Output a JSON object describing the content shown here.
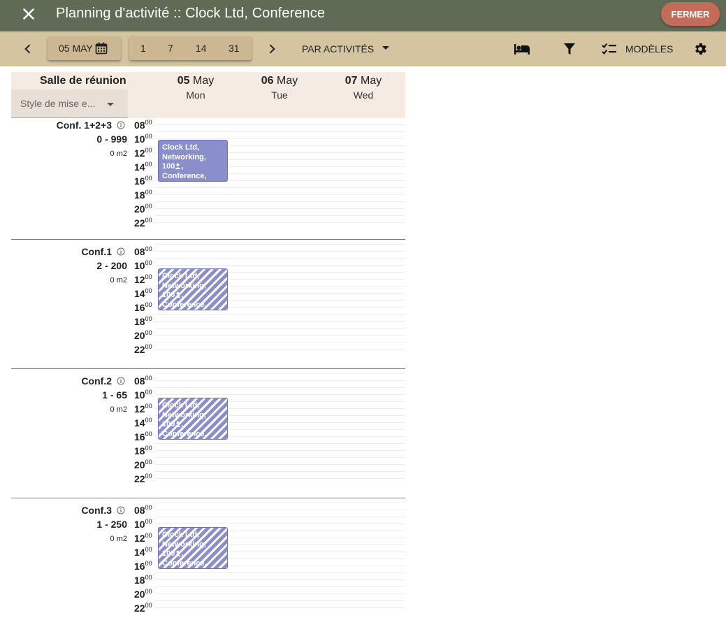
{
  "app": {
    "title": "Planning d'activité :: Clock Ltd, Conference",
    "close_button": "FERMER"
  },
  "toolbar": {
    "date_label": "05 MAY",
    "ranges": [
      "1",
      "7",
      "14",
      "31"
    ],
    "view_mode": "PAR ACTIVITÉS",
    "templates_label": "MODÈLES"
  },
  "grid": {
    "room_type_title": "Salle de réunion",
    "style_placeholder": "Style de mise e...",
    "days": [
      {
        "num": "05",
        "month": "May",
        "weekday": "Mon"
      },
      {
        "num": "06",
        "month": "May",
        "weekday": "Tue"
      },
      {
        "num": "07",
        "month": "May",
        "weekday": "Wed"
      }
    ],
    "hours": [
      "08",
      "10",
      "12",
      "14",
      "16",
      "18",
      "20",
      "22"
    ],
    "hour_suffix": "00"
  },
  "rooms": [
    {
      "name": "Conf. 1+2+3",
      "capacity": "0 - 999",
      "area": "0 m2",
      "event": {
        "line1": "Clock Ltd,",
        "line2": "Networking,",
        "line3_count": "100",
        "line3_suffix": ",",
        "line4": "Conference,",
        "style": "solid"
      }
    },
    {
      "name": "Conf.1",
      "capacity": "2 - 200",
      "area": "0 m2",
      "event": {
        "line1": "Clock Ltd,",
        "line2": "Networking,",
        "line3_count": "100",
        "line3_suffix": ",",
        "line4": "Conference,",
        "style": "striped"
      }
    },
    {
      "name": "Conf.2",
      "capacity": "1 - 65",
      "area": "0 m2",
      "event": {
        "line1": "Clock Ltd,",
        "line2": "Networking,",
        "line3_count": "100",
        "line3_suffix": ",",
        "line4": "Conference,",
        "style": "striped"
      }
    },
    {
      "name": "Conf.3",
      "capacity": "1 - 250",
      "area": "0 m2",
      "event": {
        "line1": "Clock Ltd,",
        "line2": "Networking,",
        "line3_count": "100",
        "line3_suffix": ",",
        "line4": "Conference,",
        "style": "striped"
      }
    }
  ],
  "icons": {
    "close": "close-icon",
    "prev": "chevron-left-icon",
    "next": "chevron-right-icon",
    "calendar": "calendar-icon",
    "bed": "bed-icon",
    "filter": "filter-icon",
    "checklist": "checklist-icon",
    "settings": "gear-icon",
    "info": "info-icon",
    "person": "person-icon"
  },
  "colors": {
    "topbar": "#5f6b54",
    "toolbar": "#d4c4a0",
    "close_button": "#c56b59",
    "event": "#8a8fcc",
    "header_bg": "#f5ebe3"
  }
}
